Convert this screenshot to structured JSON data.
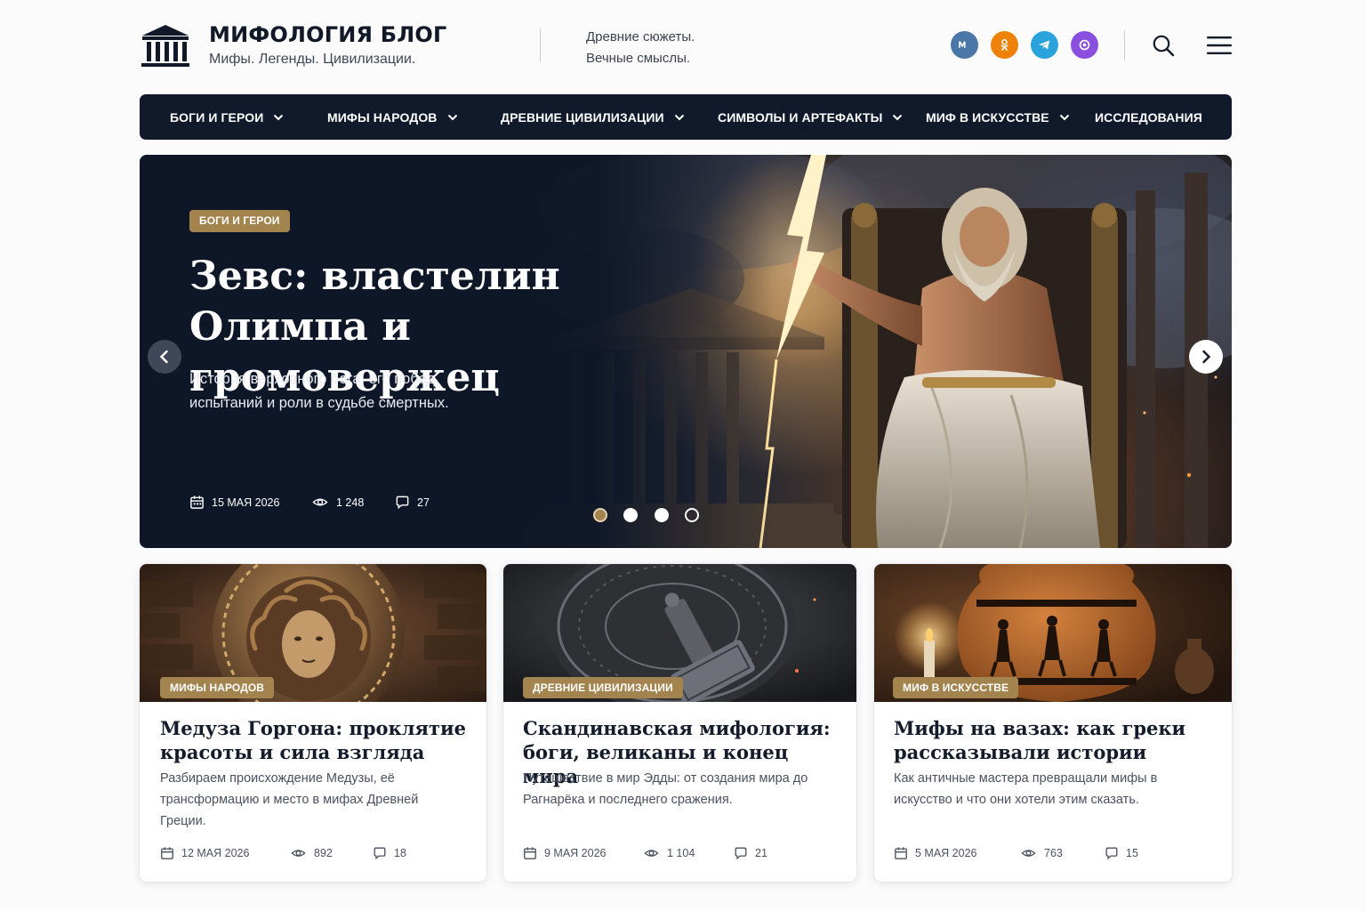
{
  "brand": {
    "title": "МИФОЛОГИЯ БЛОГ",
    "tagline": "Мифы. Легенды. Цивилизации.",
    "motto_line1": "Древние сюжеты.",
    "motto_line2": "Вечные смыслы.",
    "logo_icon": "temple-columns-icon"
  },
  "social": [
    {
      "name": "vk-icon",
      "color": "#4a76a8"
    },
    {
      "name": "odnoklassniki-icon",
      "color": "#ee8208"
    },
    {
      "name": "telegram-icon",
      "color": "#2aa3dc"
    },
    {
      "name": "podcast-icon",
      "color": "#8b4fe0"
    }
  ],
  "header_icons": [
    "search-icon",
    "menu-icon"
  ],
  "nav": {
    "items": [
      {
        "label": "БОГИ И ГЕРОИ",
        "dropdown": true
      },
      {
        "label": "МИФЫ НАРОДОВ",
        "dropdown": true
      },
      {
        "label": "ДРЕВНИЕ ЦИВИЛИЗАЦИИ",
        "dropdown": true
      },
      {
        "label": "СИМВОЛЫ И АРТЕФАКТЫ",
        "dropdown": true
      },
      {
        "label": "МИФ В ИСКУССТВЕ",
        "dropdown": true
      },
      {
        "label": "ИССЛЕДОВАНИЯ",
        "dropdown": false
      }
    ]
  },
  "hero": {
    "badge": "БОГИ И ГЕРОИ",
    "title": "Зевс: властелин Олимпа и громовержец",
    "subtitle": "История верховного бога, его побед, испытаний и роли в судьбе смертных.",
    "date": "15 МАЯ 2026",
    "views": "1 248",
    "comments": "27",
    "slides_total": 4,
    "active_slide": 1
  },
  "cards": [
    {
      "badge": "МИФЫ НАРОДОВ",
      "title": "Медуза Горгона: проклятие красоты и сила взгляда",
      "text": "Разбираем происхождение Медузы, её трансформацию и место в мифах Древней Греции.",
      "date": "12 МАЯ 2026",
      "views": "892",
      "comments": "18"
    },
    {
      "badge": "ДРЕВНИЕ ЦИВИЛИЗАЦИИ",
      "title": "Скандинавская мифология: боги, великаны и конец мира",
      "text": "Путешествие в мир Эдды: от создания мира до Рагнарёка и последнего сражения.",
      "date": "9 МАЯ 2026",
      "views": "1 104",
      "comments": "21"
    },
    {
      "badge": "МИФ В ИСКУССТВЕ",
      "title": "Мифы на вазах: как греки рассказывали истории",
      "text": "Как античные мастера превращали мифы в искусство и что они хотели этим сказать.",
      "date": "5 МАЯ 2026",
      "views": "763",
      "comments": "15"
    }
  ],
  "colors": {
    "nav_bg": "#111a2b",
    "accent_gold": "#a4844e",
    "text_dark": "#141b2b"
  }
}
